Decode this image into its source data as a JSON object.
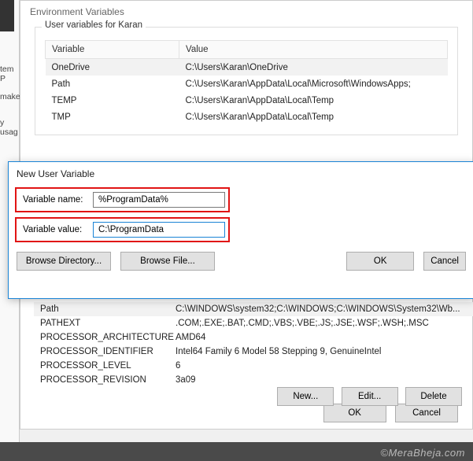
{
  "bg_left": {
    "system_p": "tem P",
    "make": "make",
    "usage": "y usag"
  },
  "env": {
    "title": "Environment Variables",
    "user_group": "User variables for Karan",
    "columns": {
      "var": "Variable",
      "val": "Value"
    },
    "user_vars": [
      {
        "name": "OneDrive",
        "value": "C:\\Users\\Karan\\OneDrive"
      },
      {
        "name": "Path",
        "value": "C:\\Users\\Karan\\AppData\\Local\\Microsoft\\WindowsApps;"
      },
      {
        "name": "TEMP",
        "value": "C:\\Users\\Karan\\AppData\\Local\\Temp"
      },
      {
        "name": "TMP",
        "value": "C:\\Users\\Karan\\AppData\\Local\\Temp"
      }
    ]
  },
  "dialog": {
    "title": "New User Variable",
    "name_label": "Variable name:",
    "name_value": "%ProgramData%",
    "value_label": "Variable value:",
    "value_value": "C:\\ProgramData",
    "browse_dir": "Browse Directory...",
    "browse_file": "Browse File...",
    "ok": "OK",
    "cancel": "Cancel"
  },
  "sys_vars": [
    {
      "name": "Path",
      "value": "C:\\WINDOWS\\system32;C:\\WINDOWS;C:\\WINDOWS\\System32\\Wb..."
    },
    {
      "name": "PATHEXT",
      "value": ".COM;.EXE;.BAT;.CMD;.VBS;.VBE;.JS;.JSE;.WSF;.WSH;.MSC"
    },
    {
      "name": "PROCESSOR_ARCHITECTURE",
      "value": "AMD64"
    },
    {
      "name": "PROCESSOR_IDENTIFIER",
      "value": "Intel64 Family 6 Model 58 Stepping 9, GenuineIntel"
    },
    {
      "name": "PROCESSOR_LEVEL",
      "value": "6"
    },
    {
      "name": "PROCESSOR_REVISION",
      "value": "3a09"
    }
  ],
  "sys_btns": {
    "new": "New...",
    "edit": "Edit...",
    "delete": "Delete"
  },
  "footer": {
    "ok": "OK",
    "cancel": "Cancel"
  },
  "watermark": "©MeraBheja.com"
}
